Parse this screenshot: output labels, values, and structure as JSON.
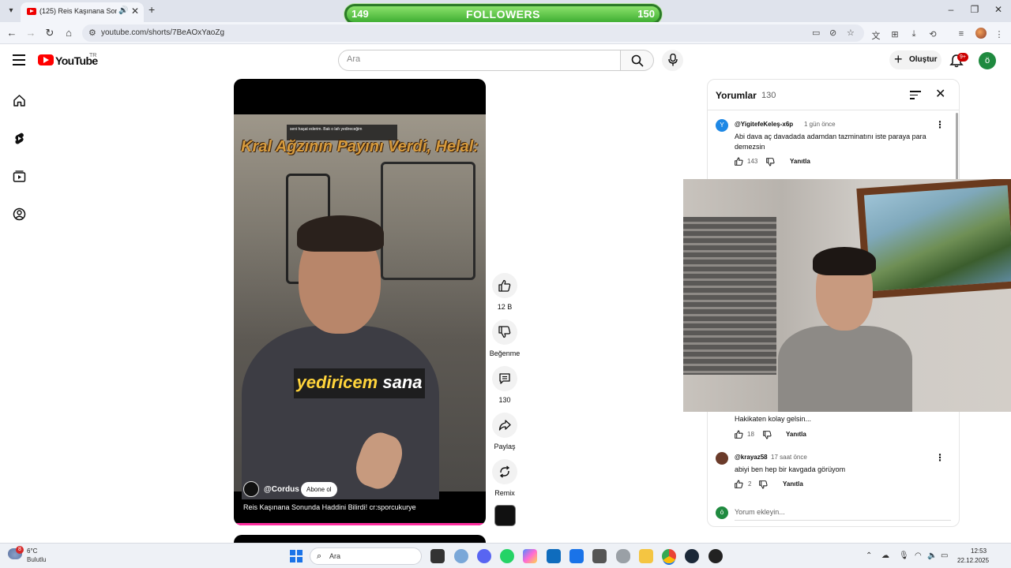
{
  "browser": {
    "tab_title": "(125) Reis Kaşınana Sonunda Haddini Bilirdi! cr:sporcukurye - YouTube",
    "url": "youtube.com/shorts/7BeAOxYaoZg",
    "new_tab": "+",
    "tab_close": "✕"
  },
  "stream_overlay": {
    "left_count": "149",
    "label": "FOLLOWERS",
    "right_count": "150"
  },
  "youtube": {
    "wordmark": "YouTube",
    "country": "TR",
    "search_placeholder": "Ara",
    "create_label": "Oluştur",
    "notifications_badge": "9+",
    "avatar_letter": "ö"
  },
  "short": {
    "caption_top": "seni haşat ederim. Bak o lafı yedireceğim",
    "title_overlay": "Kral Ağzının Payını Verdi, Helal:",
    "subtitle_word1": "yediricem",
    "subtitle_word2": "sana",
    "channel": "@Cordus",
    "subscribe": "Abone ol",
    "title": "Reis Kaşınana Sonunda Haddini Bilirdi! cr:sporcukurye"
  },
  "actions": {
    "like_count": "12 B",
    "dislike_label": "Beğenme",
    "comment_count": "130",
    "share_label": "Paylaş",
    "remix_label": "Remix"
  },
  "comments_panel": {
    "title": "Yorumlar",
    "count": "130",
    "reply_label": "Yanıtla",
    "add_placeholder": "Yorum ekleyin...",
    "add_avatar": "ö",
    "items": [
      {
        "avatar": "Y",
        "author": "@YigitefeKeleş-x6p",
        "time": "1 gün önce",
        "text": "Abi dava aç davadada adamdan tazminatını iste paraya para demezsin",
        "likes": "143"
      },
      {
        "avatar": "",
        "author": "",
        "time": "",
        "text": "Hakikaten kolay gelsin...",
        "likes": "18"
      },
      {
        "avatar": "",
        "author": "@krayaz58",
        "time": "17 saat önce",
        "text": "abiyi ben hep bir kavgada görüyom",
        "likes": "2"
      }
    ]
  },
  "taskbar": {
    "weather_temp": "6°C",
    "weather_desc": "Bulutlu",
    "weather_badge": "8",
    "search": "Ara",
    "time": "12:53",
    "date": "22.12.2025"
  },
  "colors": {
    "youtube_red": "#ff0000",
    "followers_green": "#3fae33",
    "avatar_green": "#1f8a3f",
    "caption_gold": "#d79b3d"
  }
}
